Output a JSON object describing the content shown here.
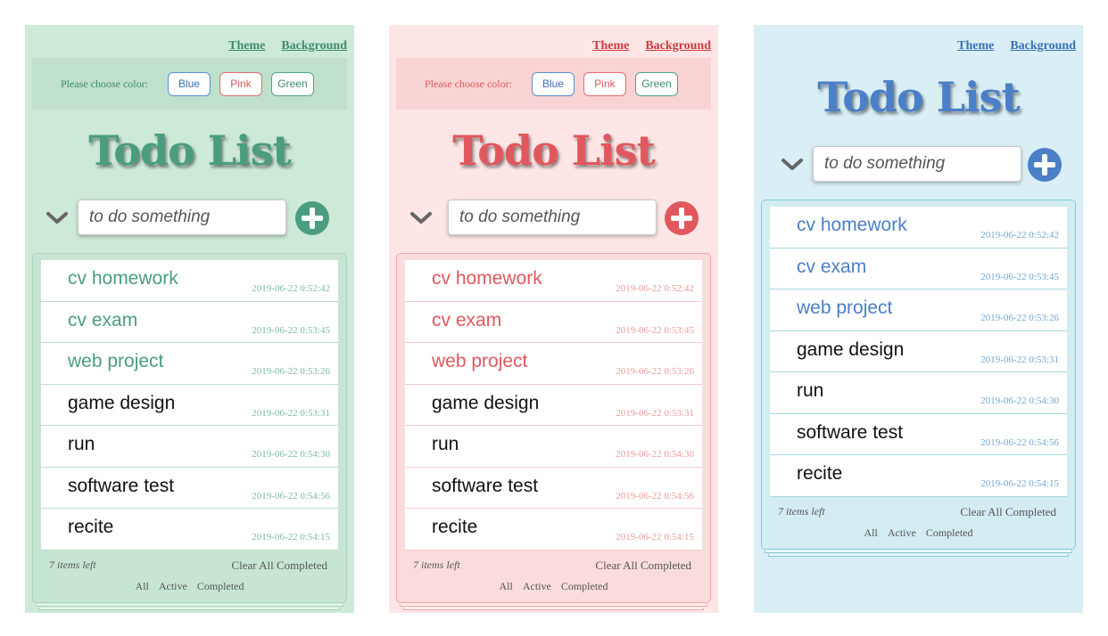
{
  "header": {
    "theme_label": "Theme",
    "background_label": "Background"
  },
  "chooser": {
    "label": "Please choose color:",
    "options": [
      "Blue",
      "Pink",
      "Green"
    ]
  },
  "app": {
    "title": "Todo List",
    "input_placeholder": "to do something"
  },
  "todos": [
    {
      "text": "cv homework",
      "date": "2019-06-22 0:52:42",
      "completed": true
    },
    {
      "text": "cv exam",
      "date": "2019-06-22 0:53:45",
      "completed": true
    },
    {
      "text": "web project",
      "date": "2019-06-22 0:53:26",
      "completed": true
    },
    {
      "text": "game design",
      "date": "2019-06-22 0:53:31",
      "completed": false
    },
    {
      "text": "run",
      "date": "2019-06-22 0:54:30",
      "completed": false
    },
    {
      "text": "software test",
      "date": "2019-06-22 0:54:56",
      "completed": false
    },
    {
      "text": "recite",
      "date": "2019-06-22 0:54:15",
      "completed": false
    }
  ],
  "footer": {
    "items_left": "7 items left",
    "clear_label": "Clear All Completed",
    "filters": [
      "All",
      "Active",
      "Completed"
    ]
  },
  "themes": {
    "green": {
      "bg": "#cde9d8",
      "accent": "#4a9d7e",
      "chooser_bg": "#bfe0cc",
      "border": "#a9d6bd",
      "link": "#3e8c6e"
    },
    "pink": {
      "bg": "#fde6e5",
      "accent": "#e0585d",
      "chooser_bg": "#f9d3d3",
      "border": "#f2a9aa",
      "link": "#cc3b40"
    },
    "blue": {
      "bg": "#d9eff5",
      "accent": "#4b7fc8",
      "chooser_bg": "",
      "border": "#86c9d4",
      "link": "#3a6fb8"
    }
  }
}
